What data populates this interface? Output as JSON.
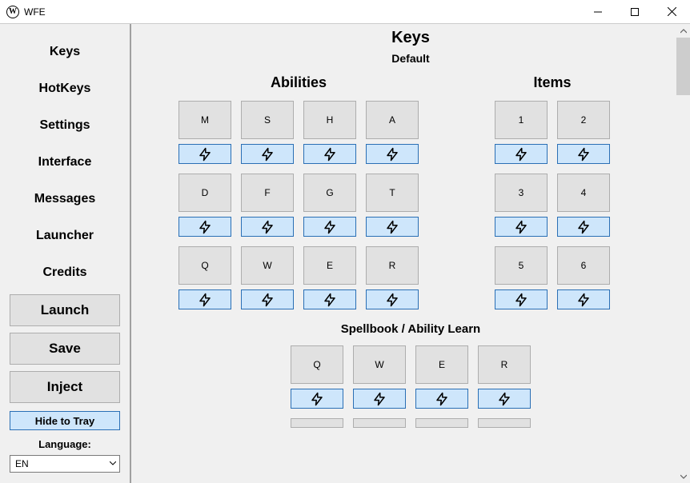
{
  "window": {
    "title": "WFE",
    "icon_letter": "W"
  },
  "sidebar": {
    "nav": [
      "Keys",
      "HotKeys",
      "Settings",
      "Interface",
      "Messages",
      "Launcher",
      "Credits"
    ],
    "buttons": {
      "launch": "Launch",
      "save": "Save",
      "inject": "Inject",
      "hide_tray": "Hide to Tray"
    },
    "language_label": "Language:",
    "language_value": "EN"
  },
  "main": {
    "title": "Keys",
    "subtitle": "Default",
    "abilities_title": "Abilities",
    "items_title": "Items",
    "spellbook_title": "Spellbook / Ability Learn",
    "abilities": [
      [
        "M",
        "S",
        "H",
        "A"
      ],
      [
        "D",
        "F",
        "G",
        "T"
      ],
      [
        "Q",
        "W",
        "E",
        "R"
      ]
    ],
    "items": [
      [
        "1",
        "2"
      ],
      [
        "3",
        "4"
      ],
      [
        "5",
        "6"
      ]
    ],
    "spellbook": [
      [
        "Q",
        "W",
        "E",
        "R"
      ]
    ]
  }
}
